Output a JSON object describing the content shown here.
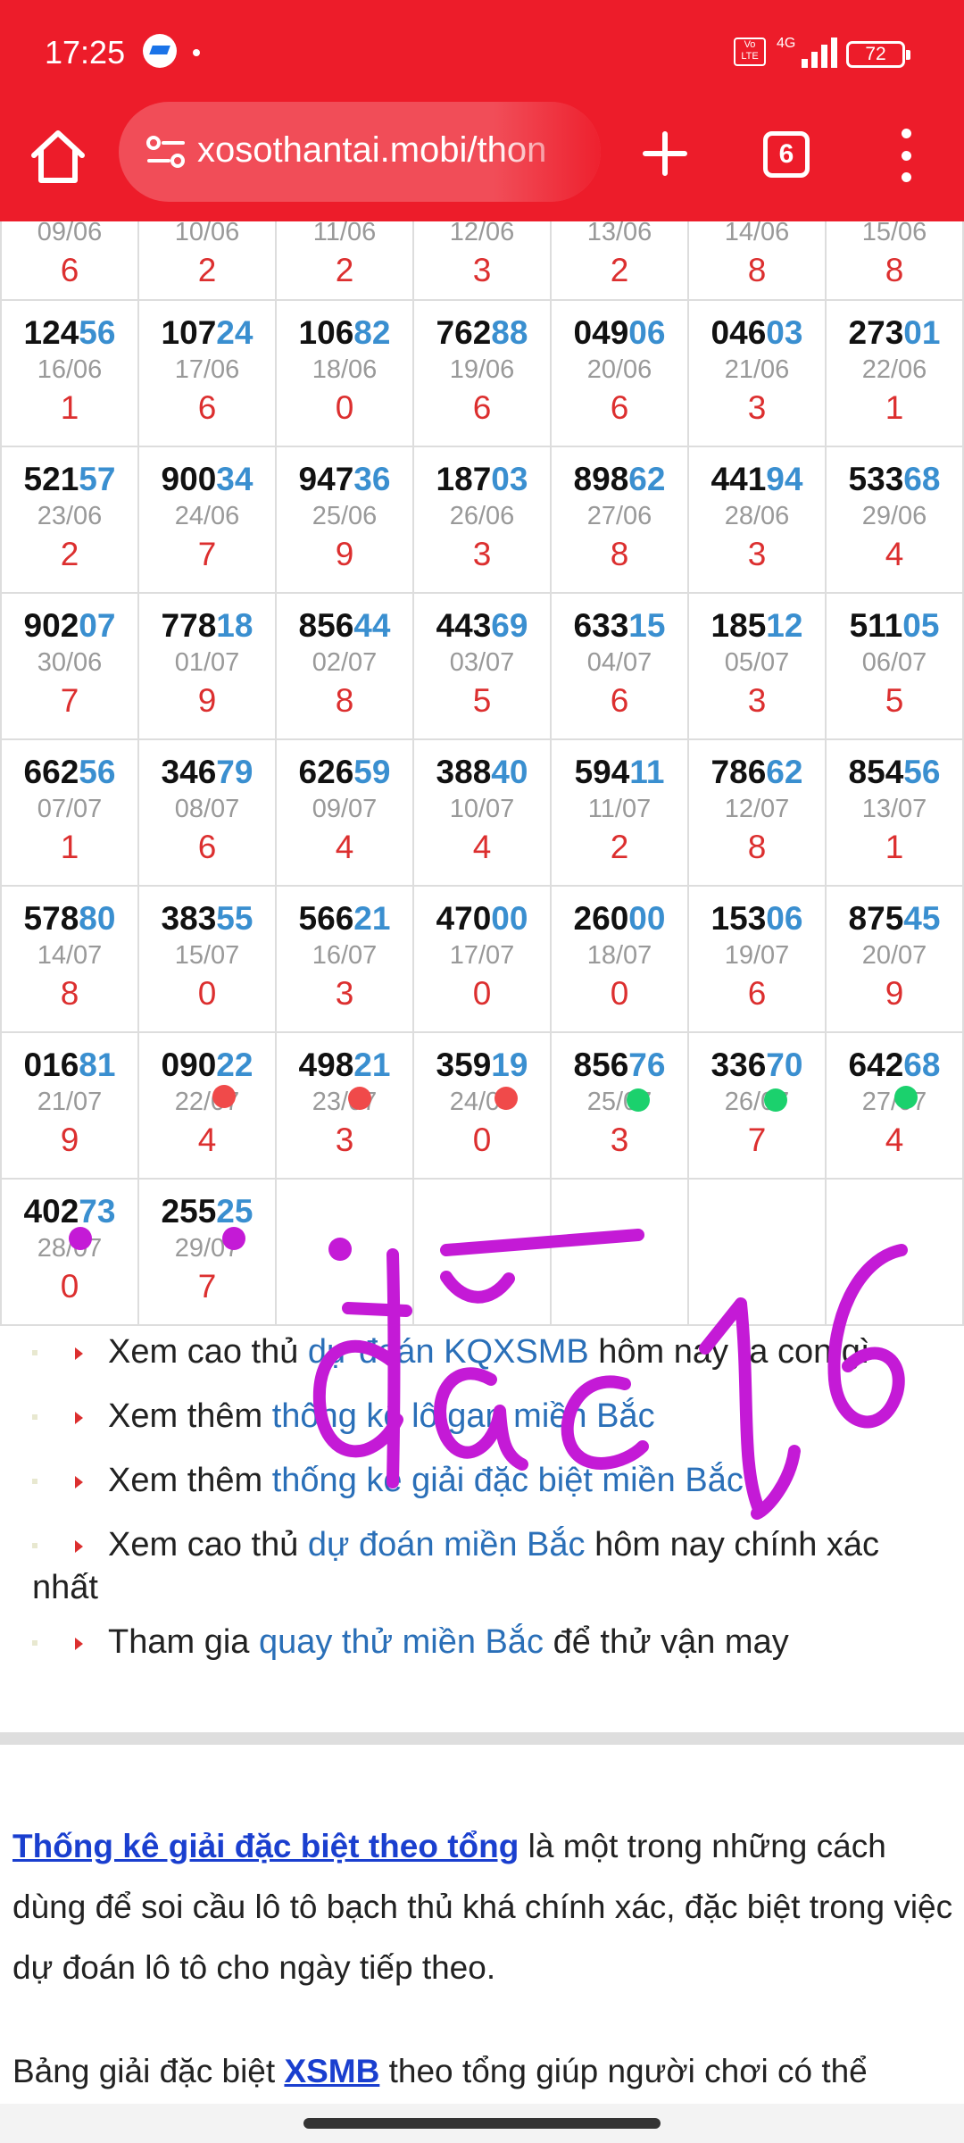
{
  "status_bar": {
    "time": "17:25",
    "network": "4G",
    "volte": "Vo LTE",
    "battery": "72"
  },
  "browser": {
    "url": "xosothantai.mobi/thon",
    "tab_count": "6"
  },
  "grid": [
    [
      {
        "pre": "",
        "suf": "",
        "date": "09/06",
        "sum": "6"
      },
      {
        "pre": "",
        "suf": "",
        "date": "10/06",
        "sum": "2"
      },
      {
        "pre": "",
        "suf": "",
        "date": "11/06",
        "sum": "2"
      },
      {
        "pre": "",
        "suf": "",
        "date": "12/06",
        "sum": "3"
      },
      {
        "pre": "",
        "suf": "",
        "date": "13/06",
        "sum": "2"
      },
      {
        "pre": "",
        "suf": "",
        "date": "14/06",
        "sum": "8"
      },
      {
        "pre": "",
        "suf": "",
        "date": "15/06",
        "sum": "8"
      }
    ],
    [
      {
        "pre": "124",
        "suf": "56",
        "date": "16/06",
        "sum": "1"
      },
      {
        "pre": "107",
        "suf": "24",
        "date": "17/06",
        "sum": "6"
      },
      {
        "pre": "106",
        "suf": "82",
        "date": "18/06",
        "sum": "0"
      },
      {
        "pre": "762",
        "suf": "88",
        "date": "19/06",
        "sum": "6"
      },
      {
        "pre": "049",
        "suf": "06",
        "date": "20/06",
        "sum": "6"
      },
      {
        "pre": "046",
        "suf": "03",
        "date": "21/06",
        "sum": "3"
      },
      {
        "pre": "273",
        "suf": "01",
        "date": "22/06",
        "sum": "1"
      }
    ],
    [
      {
        "pre": "521",
        "suf": "57",
        "date": "23/06",
        "sum": "2"
      },
      {
        "pre": "900",
        "suf": "34",
        "date": "24/06",
        "sum": "7"
      },
      {
        "pre": "947",
        "suf": "36",
        "date": "25/06",
        "sum": "9"
      },
      {
        "pre": "187",
        "suf": "03",
        "date": "26/06",
        "sum": "3"
      },
      {
        "pre": "898",
        "suf": "62",
        "date": "27/06",
        "sum": "8"
      },
      {
        "pre": "441",
        "suf": "94",
        "date": "28/06",
        "sum": "3"
      },
      {
        "pre": "533",
        "suf": "68",
        "date": "29/06",
        "sum": "4"
      }
    ],
    [
      {
        "pre": "902",
        "suf": "07",
        "date": "30/06",
        "sum": "7"
      },
      {
        "pre": "778",
        "suf": "18",
        "date": "01/07",
        "sum": "9"
      },
      {
        "pre": "856",
        "suf": "44",
        "date": "02/07",
        "sum": "8"
      },
      {
        "pre": "443",
        "suf": "69",
        "date": "03/07",
        "sum": "5"
      },
      {
        "pre": "633",
        "suf": "15",
        "date": "04/07",
        "sum": "6"
      },
      {
        "pre": "185",
        "suf": "12",
        "date": "05/07",
        "sum": "3"
      },
      {
        "pre": "511",
        "suf": "05",
        "date": "06/07",
        "sum": "5"
      }
    ],
    [
      {
        "pre": "662",
        "suf": "56",
        "date": "07/07",
        "sum": "1"
      },
      {
        "pre": "346",
        "suf": "79",
        "date": "08/07",
        "sum": "6"
      },
      {
        "pre": "626",
        "suf": "59",
        "date": "09/07",
        "sum": "4"
      },
      {
        "pre": "388",
        "suf": "40",
        "date": "10/07",
        "sum": "4"
      },
      {
        "pre": "594",
        "suf": "11",
        "date": "11/07",
        "sum": "2"
      },
      {
        "pre": "786",
        "suf": "62",
        "date": "12/07",
        "sum": "8"
      },
      {
        "pre": "854",
        "suf": "56",
        "date": "13/07",
        "sum": "1"
      }
    ],
    [
      {
        "pre": "578",
        "suf": "80",
        "date": "14/07",
        "sum": "8"
      },
      {
        "pre": "383",
        "suf": "55",
        "date": "15/07",
        "sum": "0"
      },
      {
        "pre": "566",
        "suf": "21",
        "date": "16/07",
        "sum": "3"
      },
      {
        "pre": "470",
        "suf": "00",
        "date": "17/07",
        "sum": "0"
      },
      {
        "pre": "260",
        "suf": "00",
        "date": "18/07",
        "sum": "0"
      },
      {
        "pre": "153",
        "suf": "06",
        "date": "19/07",
        "sum": "6"
      },
      {
        "pre": "875",
        "suf": "45",
        "date": "20/07",
        "sum": "9"
      }
    ],
    [
      {
        "pre": "016",
        "suf": "81",
        "date": "21/07",
        "sum": "9"
      },
      {
        "pre": "090",
        "suf": "22",
        "date": "22/07",
        "sum": "4"
      },
      {
        "pre": "498",
        "suf": "21",
        "date": "23/07",
        "sum": "3"
      },
      {
        "pre": "359",
        "suf": "19",
        "date": "24/07",
        "sum": "0"
      },
      {
        "pre": "856",
        "suf": "76",
        "date": "25/07",
        "sum": "3"
      },
      {
        "pre": "336",
        "suf": "70",
        "date": "26/07",
        "sum": "7"
      },
      {
        "pre": "642",
        "suf": "68",
        "date": "27/07",
        "sum": "4"
      }
    ],
    [
      {
        "pre": "402",
        "suf": "73",
        "date": "28/07",
        "sum": "0"
      },
      {
        "pre": "255",
        "suf": "25",
        "date": "29/07",
        "sum": "7"
      },
      {
        "pre": "",
        "suf": "",
        "date": "",
        "sum": ""
      },
      {
        "pre": "",
        "suf": "",
        "date": "",
        "sum": ""
      },
      {
        "pre": "",
        "suf": "",
        "date": "",
        "sum": ""
      },
      {
        "pre": "",
        "suf": "",
        "date": "",
        "sum": ""
      },
      {
        "pre": "",
        "suf": "",
        "date": "",
        "sum": ""
      }
    ]
  ],
  "marker_colors": {
    "red": "#f04a4a",
    "green": "#1bd16d",
    "purple": "#c41ad6"
  },
  "links": [
    {
      "before": "Xem cao thủ ",
      "link": "dự đoán KQXSMB",
      "after": " hôm nay ra con gì"
    },
    {
      "before": "Xem thêm ",
      "link": "thống kê lô gan miền Bắc",
      "after": ""
    },
    {
      "before": "Xem thêm ",
      "link": "thống kê giải đặc biệt miền Bắc",
      "after": ""
    },
    {
      "before": "Xem cao thủ ",
      "link": "dự đoán miền Bắc",
      "after": " hôm nay chính xác nhất"
    },
    {
      "before": "Tham gia ",
      "link": "quay thử miền Bắc",
      "after": " để thử vận may"
    }
  ],
  "article": {
    "p1_link": "Thống kê giải đặc biệt theo tổng",
    "p1_text": " là một trong những cách dùng để soi cầu lô tô bạch thủ khá chính xác, đặc biệt trong việc dự đoán lô tô cho ngày tiếp theo.",
    "p2_before": "Bảng giải đặc biệt ",
    "p2_link": "XSMB",
    "p2_after": " theo tổng giúp người chơi có thể"
  },
  "handwriting": "đặc 1,6"
}
